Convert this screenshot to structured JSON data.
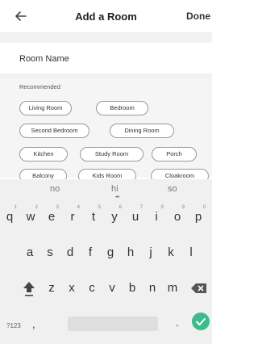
{
  "header": {
    "title": "Add a Room",
    "done_label": "Done",
    "back_icon": "arrow-left-icon"
  },
  "room_name": {
    "placeholder": "Room Name",
    "value": ""
  },
  "recommended": {
    "label": "Recommended",
    "chips": [
      "Living Room",
      "Bedroom",
      "Second Bedroom",
      "Dining Room",
      "Kitchen",
      "Study Room",
      "Porch",
      "Balcony",
      "Kids Room",
      "Cloakroom"
    ]
  },
  "keyboard": {
    "suggestions": [
      "no",
      "hi",
      "so"
    ],
    "row1": [
      {
        "key": "q",
        "num": "1"
      },
      {
        "key": "w",
        "num": "2"
      },
      {
        "key": "e",
        "num": "3"
      },
      {
        "key": "r",
        "num": "4"
      },
      {
        "key": "t",
        "num": "5"
      },
      {
        "key": "y",
        "num": "6"
      },
      {
        "key": "u",
        "num": "7"
      },
      {
        "key": "i",
        "num": "8"
      },
      {
        "key": "o",
        "num": "9"
      },
      {
        "key": "p",
        "num": "0"
      }
    ],
    "row2": [
      "a",
      "s",
      "d",
      "f",
      "g",
      "h",
      "j",
      "k",
      "l"
    ],
    "row3": [
      "z",
      "x",
      "c",
      "v",
      "b",
      "n",
      "m"
    ],
    "symbols_label": "?123",
    "comma": ",",
    "period": ".",
    "accent_color": "#3dbb8c"
  }
}
